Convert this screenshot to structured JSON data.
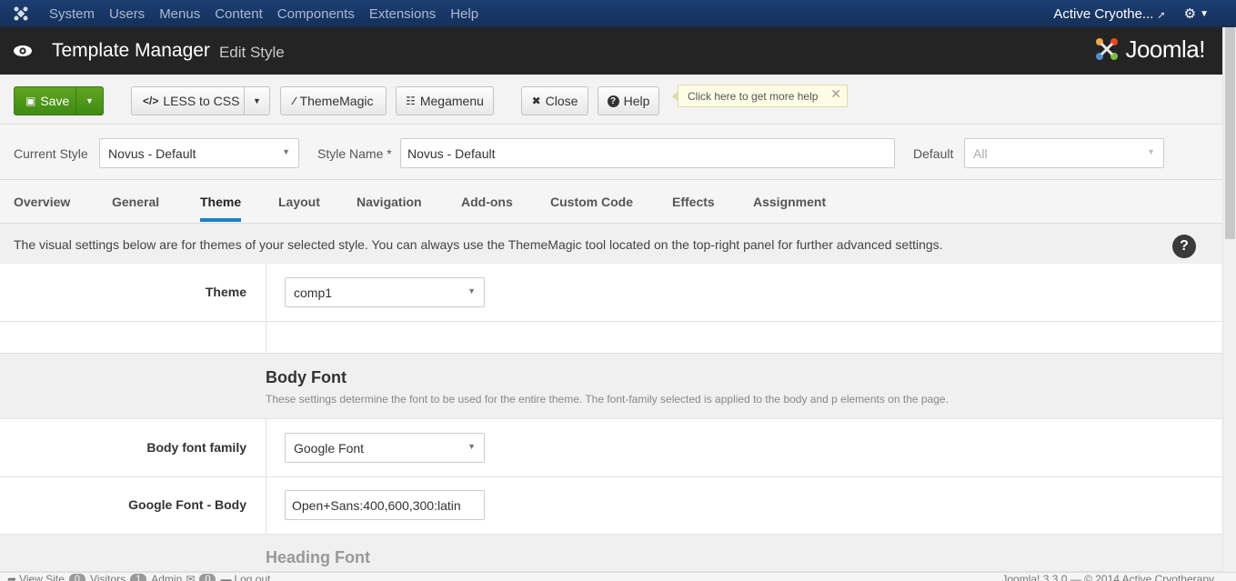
{
  "topnav": {
    "menu": [
      "System",
      "Users",
      "Menus",
      "Content",
      "Components",
      "Extensions",
      "Help"
    ],
    "user_name": "Active Cryothe..."
  },
  "header": {
    "title": "Template Manager",
    "subtitle": "Edit Style",
    "brand": "Joomla!"
  },
  "toolbar": {
    "save": "Save",
    "less": "LESS to CSS",
    "thememagic": "ThemeMagic",
    "megamenu": "Megamenu",
    "close": "Close",
    "help": "Help",
    "tip": "Click here to get more help"
  },
  "style_row": {
    "current_style_label": "Current Style",
    "current_style_value": "Novus - Default",
    "style_name_label": "Style Name *",
    "style_name_value": "Novus - Default",
    "default_label": "Default",
    "default_value": "All"
  },
  "tabs": [
    "Overview",
    "General",
    "Theme",
    "Layout",
    "Navigation",
    "Add-ons",
    "Custom Code",
    "Effects",
    "Assignment"
  ],
  "active_tab": "Theme",
  "info_text": "The visual settings below are for themes of your selected style. You can always use the ThemeMagic tool located on the top-right panel for further advanced settings.",
  "fields": {
    "theme_label": "Theme",
    "theme_value": "comp1",
    "body_font_heading": "Body Font",
    "body_font_desc": "These settings determine the font to be used for the entire theme. The font-family selected is applied to the body and p elements on the page.",
    "body_font_family_label": "Body font family",
    "body_font_family_value": "Google Font",
    "google_font_body_label": "Google Font - Body",
    "google_font_body_value": "Open+Sans:400,600,300:latin",
    "heading_font_heading": "Heading Font"
  },
  "status": {
    "view_site": "View Site",
    "visitors_count": "0",
    "visitors": "Visitors",
    "admin_count": "1",
    "admin": "Admin",
    "messages_count": "0",
    "logout": "Log out",
    "version": "Joomla! 3.3.0 — © 2014 Active Cryotherapy"
  }
}
